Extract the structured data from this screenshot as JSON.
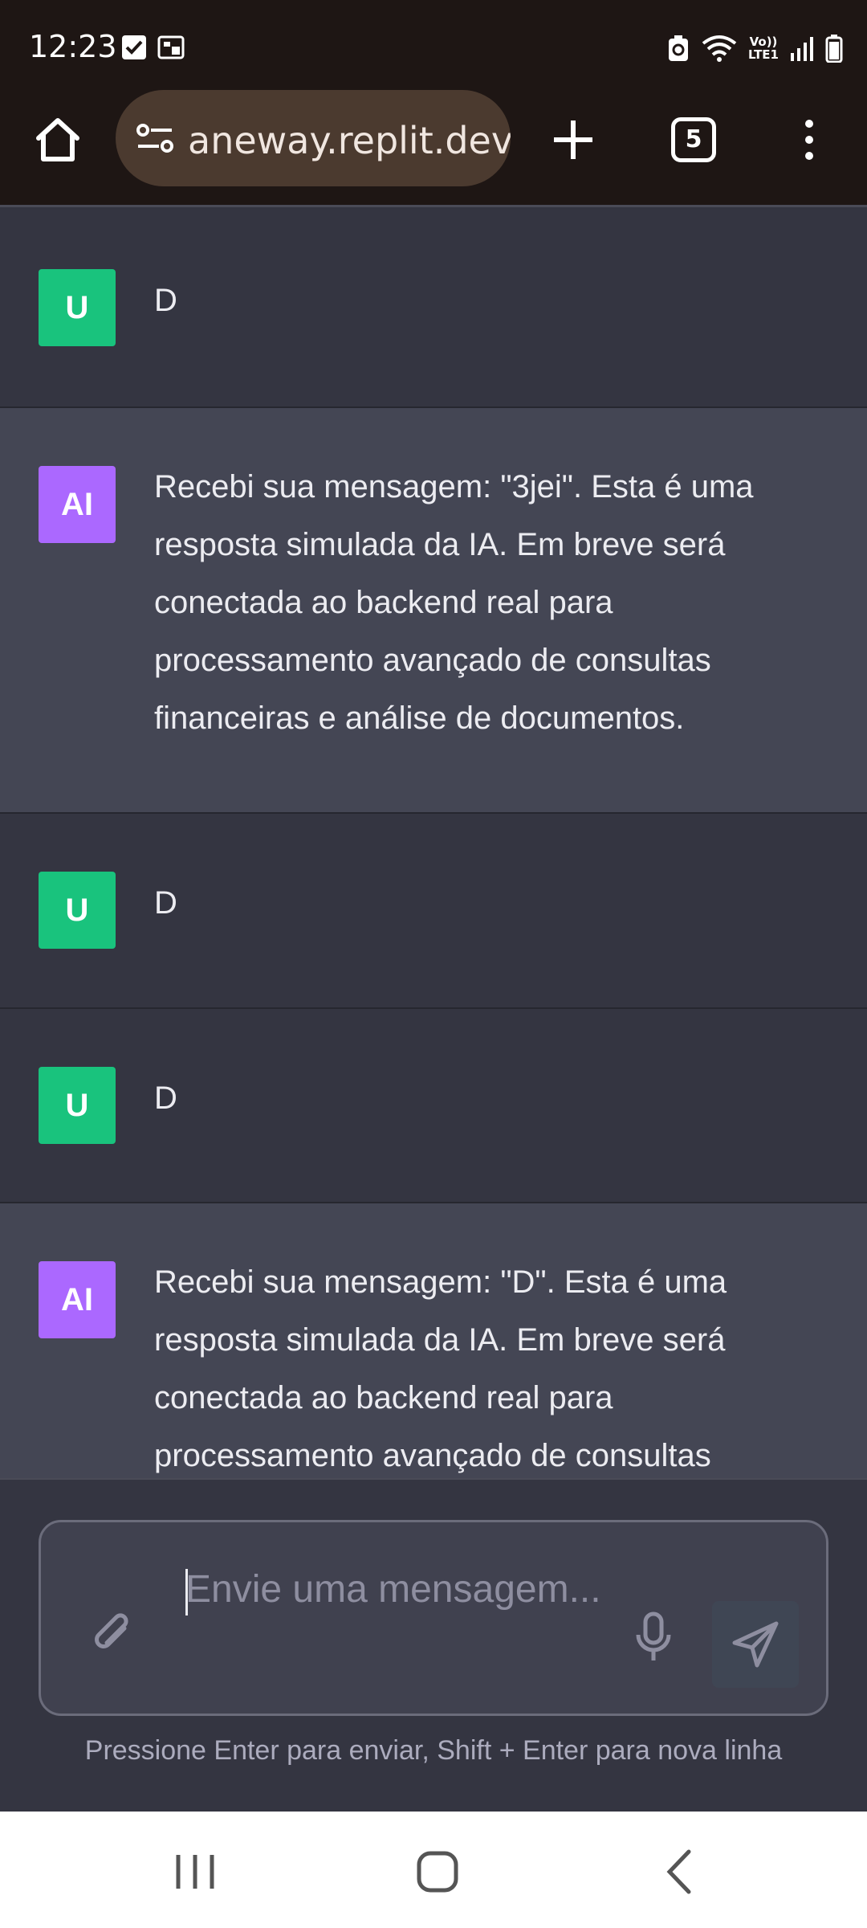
{
  "status_bar": {
    "time": "12:23",
    "volte_top": "Vo))",
    "volte_bottom": "LTE1"
  },
  "browser": {
    "url": "aneway.replit.dev",
    "tab_count": "5"
  },
  "messages": [
    {
      "role": "user",
      "avatar": "U",
      "text": "D"
    },
    {
      "role": "ai",
      "avatar": "AI",
      "text": "Recebi sua mensagem: \"3jei\". Esta é uma resposta simulada da IA. Em breve será conectada ao backend real para processamento avançado de consultas financeiras e análise de documentos."
    },
    {
      "role": "user",
      "avatar": "U",
      "text": "D"
    },
    {
      "role": "user",
      "avatar": "U",
      "text": "D"
    },
    {
      "role": "ai",
      "avatar": "AI",
      "text": "Recebi sua mensagem: \"D\". Esta é uma resposta simulada da IA. Em breve será conectada ao backend real para processamento avançado de consultas"
    }
  ],
  "composer": {
    "placeholder": "Envie uma mensagem...",
    "hint": "Pressione Enter para enviar, Shift + Enter para nova linha"
  },
  "colors": {
    "user_avatar": "#19c37d",
    "ai_avatar": "#ab68ff",
    "chat_bg": "#343541",
    "ai_bg": "#444654"
  }
}
